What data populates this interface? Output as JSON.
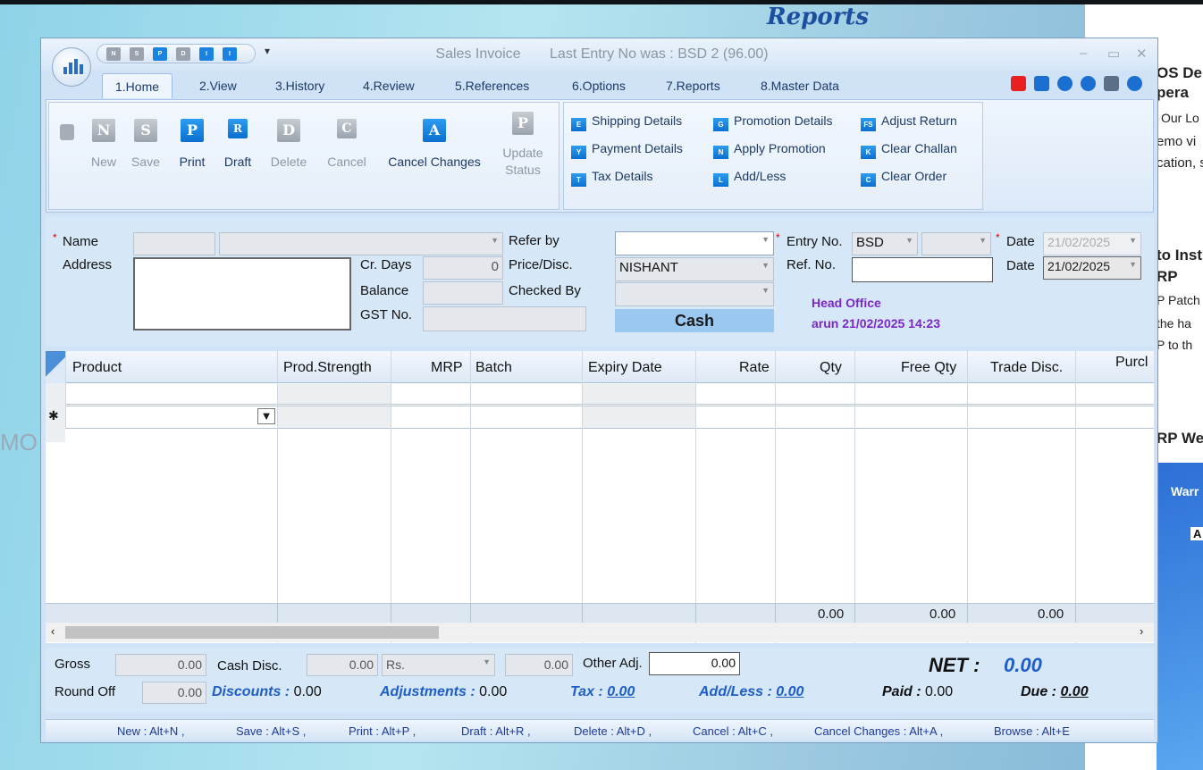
{
  "background": {
    "title": "Reports",
    "right_texts": [
      "OS De",
      "pera",
      "Our Lo",
      "emo vi",
      "cation, s",
      "to Inst",
      "RP",
      "P Patch",
      "the ha",
      "P to th",
      "RP We",
      "Warr",
      "A"
    ],
    "left_text": "MO"
  },
  "window": {
    "title": "Sales Invoice",
    "last_entry": "Last Entry No was : BSD 2  (96.00)",
    "controls": [
      "–",
      "▭",
      "✕"
    ]
  },
  "qat": [
    "N",
    "S",
    "P",
    "D",
    "I",
    "I"
  ],
  "tabs": [
    {
      "label": "1.Home"
    },
    {
      "label": "2.View"
    },
    {
      "label": "3.History"
    },
    {
      "label": "4.Review"
    },
    {
      "label": "5.References"
    },
    {
      "label": "6.Options"
    },
    {
      "label": "7.Reports"
    },
    {
      "label": "8.Master Data"
    }
  ],
  "ribbon": {
    "buttons": [
      {
        "label": "New",
        "glyph": "N",
        "enabled": false
      },
      {
        "label": "Save",
        "glyph": "S",
        "enabled": false
      },
      {
        "label": "Print",
        "glyph": "P",
        "enabled": true
      },
      {
        "label": "Draft",
        "glyph": "R",
        "enabled": true
      },
      {
        "label": "Delete",
        "glyph": "D",
        "enabled": false
      },
      {
        "label": "Cancel",
        "glyph": "C",
        "enabled": false
      },
      {
        "label": "Cancel Changes",
        "glyph": "A",
        "enabled": true
      },
      {
        "label1": "Update",
        "label2": "Status",
        "glyph": "P",
        "enabled": false
      }
    ],
    "small": [
      {
        "label": "Shipping Details",
        "glyph": "E"
      },
      {
        "label": "Payment Details",
        "glyph": "Y"
      },
      {
        "label": "Tax Details",
        "glyph": "T"
      },
      {
        "label": "Promotion Details",
        "glyph": "G"
      },
      {
        "label": "Apply Promotion",
        "glyph": "N"
      },
      {
        "label": "Add/Less",
        "glyph": "L"
      },
      {
        "label": "Adjust Return",
        "glyph": "FS"
      },
      {
        "label": "Clear Challan",
        "glyph": "K"
      },
      {
        "label": "Clear Order",
        "glyph": "C"
      }
    ]
  },
  "form": {
    "name_label": "Name",
    "address_label": "Address",
    "cr_days_label": "Cr. Days",
    "cr_days_value": "0",
    "balance_label": "Balance",
    "gst_label": "GST No.",
    "refer_by_label": "Refer by",
    "price_disc_label": "Price/Disc.",
    "price_disc_value": "NISHANT",
    "checked_by_label": "Checked By",
    "cash_label": "Cash",
    "entry_no_label": "Entry No.",
    "entry_no_prefix": "BSD",
    "ref_no_label": "Ref. No.",
    "date_label": "Date",
    "date1_value": "21/02/2025",
    "date2_label": "Date",
    "date2_value": "21/02/2025",
    "office": "Head Office",
    "user_stamp": "arun 21/02/2025 14:23"
  },
  "grid": {
    "columns": [
      "Product",
      "Prod.Strength",
      "MRP",
      "Batch",
      "Expiry Date",
      "Rate",
      "Qty",
      "Free Qty",
      "Trade Disc.",
      "Purcl"
    ],
    "new_row_marker": "✱",
    "footer": {
      "qty": "0.00",
      "free_qty": "0.00",
      "trade_disc": "0.00"
    }
  },
  "totals": {
    "gross_label": "Gross",
    "gross_value": "0.00",
    "cash_disc_label": "Cash Disc.",
    "cash_disc_value": "0.00",
    "cash_disc_unit": "Rs.",
    "cash_disc_amount": "0.00",
    "other_adj_label": "Other Adj.",
    "other_adj_value": "0.00",
    "net_label": "NET :",
    "net_value": "0.00",
    "round_off_label": "Round Off",
    "round_off_value": "0.00",
    "discounts_label": "Discounts :",
    "discounts_value": "0.00",
    "adjustments_label": "Adjustments :",
    "adjustments_value": "0.00",
    "tax_label": "Tax :",
    "tax_value": "0.00",
    "addless_label": "Add/Less :",
    "addless_value": "0.00",
    "paid_label": "Paid :",
    "paid_value": "0.00",
    "due_label": "Due :",
    "due_value": "0.00"
  },
  "shortcuts": [
    "New : Alt+N ,",
    "Save : Alt+S ,",
    "Print : Alt+P ,",
    "Draft : Alt+R ,",
    "Delete : Alt+D ,",
    "Cancel : Alt+C ,",
    "Cancel Changes : Alt+A ,",
    "Browse : Alt+E"
  ],
  "colors": {
    "accent": "#1e5ec8",
    "ribbon_bg": "#dce9f8",
    "form_bg": "#d6e7f8",
    "purple": "#7a28c8"
  }
}
